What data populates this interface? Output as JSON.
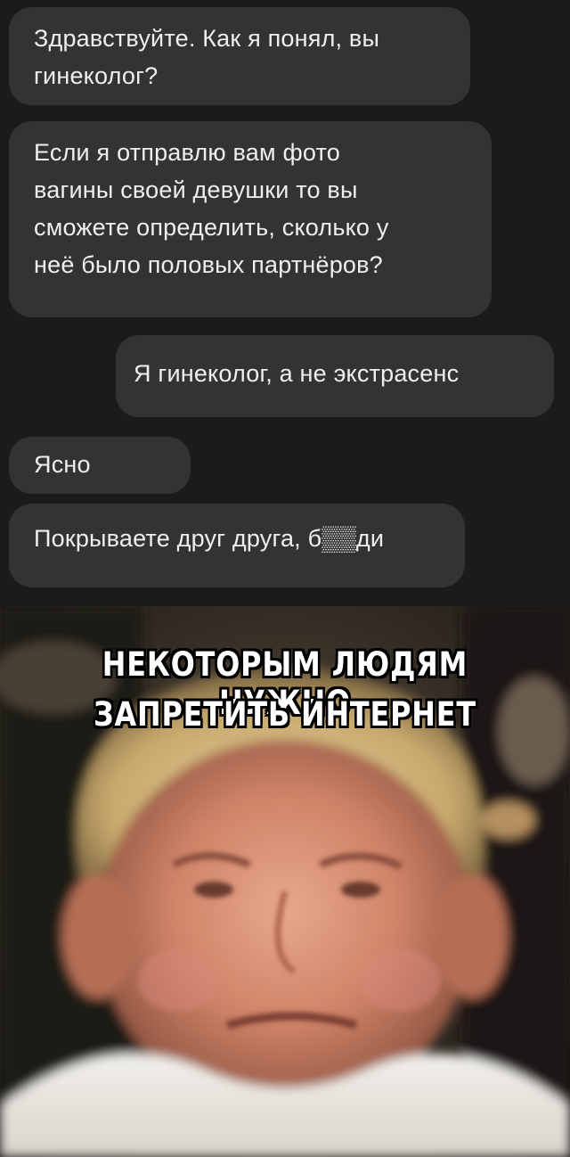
{
  "messages": [
    {
      "direction": "incoming",
      "text": "Здравствуйте. Как я понял, вы\nгинеколог?"
    },
    {
      "direction": "incoming",
      "text": "Если я отправлю вам фото\nвагины своей девушки то вы\nсможете определить, сколько у\nнеё было половых партнёров?"
    },
    {
      "direction": "outgoing",
      "text": "Я гинеколог, а не экстрасенс"
    },
    {
      "direction": "incoming",
      "text": "Ясно"
    },
    {
      "direction": "incoming",
      "text": "Покрываете друг друга, б▒▒ди"
    }
  ],
  "meme": {
    "line1": "НЕКОТОРЫМ ЛЮДЯМ НУЖНО",
    "line2": "ЗАПРЕТИТЬ ИНТЕРНЕТ"
  },
  "colors": {
    "background": "#1b1b1d",
    "bubble": "#333335",
    "text": "#efeff1"
  }
}
